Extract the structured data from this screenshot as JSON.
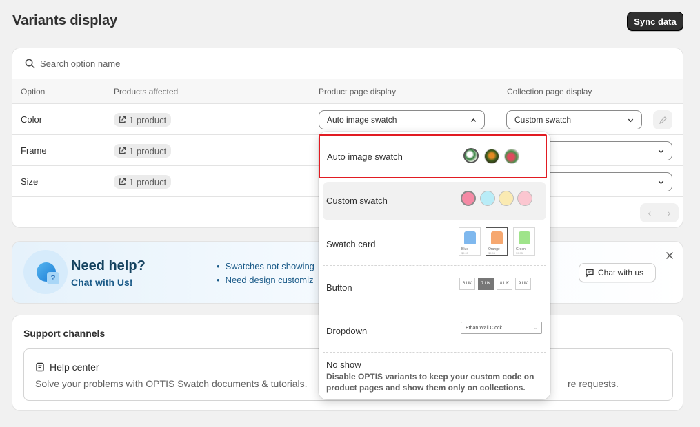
{
  "page": {
    "title": "Variants display",
    "sync_button": "Sync data"
  },
  "search": {
    "placeholder": "Search option name"
  },
  "table": {
    "headers": [
      "Option",
      "Products affected",
      "Product page display",
      "Collection page display"
    ],
    "rows": [
      {
        "option": "Color",
        "products": "1 product",
        "product_display": "Auto image swatch",
        "collection_display": "Custom swatch"
      },
      {
        "option": "Frame",
        "products": "1 product",
        "product_display": "",
        "collection_display": ""
      },
      {
        "option": "Size",
        "products": "1 product",
        "product_display": "",
        "collection_display": ""
      }
    ]
  },
  "help": {
    "title": "Need help?",
    "subtitle": "Chat with Us!",
    "bullets": [
      "Swatches not showing",
      "Need design customiz"
    ],
    "chat_button": "Chat with us"
  },
  "support": {
    "title": "Support channels",
    "help_center_title": "Help center",
    "help_center_desc": "Solve your problems with OPTIS Swatch documents & tutorials.",
    "right_desc": "re requests."
  },
  "dropdown": {
    "options": [
      {
        "label": "Auto image swatch",
        "selected": true
      },
      {
        "label": "Custom swatch",
        "hover": true
      },
      {
        "label": "Swatch card"
      },
      {
        "label": "Button"
      },
      {
        "label": "Dropdown"
      }
    ],
    "custom_swatch_colors": [
      "#f58aa5",
      "#b9ecf7",
      "#faeab2",
      "#fbc6d0"
    ],
    "swatch_cards": [
      {
        "name": "Blue",
        "price": "$9.95",
        "color": "#7fb8ee"
      },
      {
        "name": "Orange",
        "price": "$9.95",
        "color": "#f6a870"
      },
      {
        "name": "Green",
        "price": "$9.95",
        "color": "#9fe48a"
      }
    ],
    "buttons": [
      "6 UK",
      "7 UK",
      "8 UK",
      "9 UK"
    ],
    "dropdown_preview": "Ethan Wall Clock",
    "no_show_title": "No show",
    "no_show_desc": "Disable OPTIS variants to keep your custom code on product pages and show them only on collections."
  },
  "colors": {
    "accent_dark": "#303030",
    "highlight": "#e11b22",
    "help_text": "#1a5a88"
  }
}
